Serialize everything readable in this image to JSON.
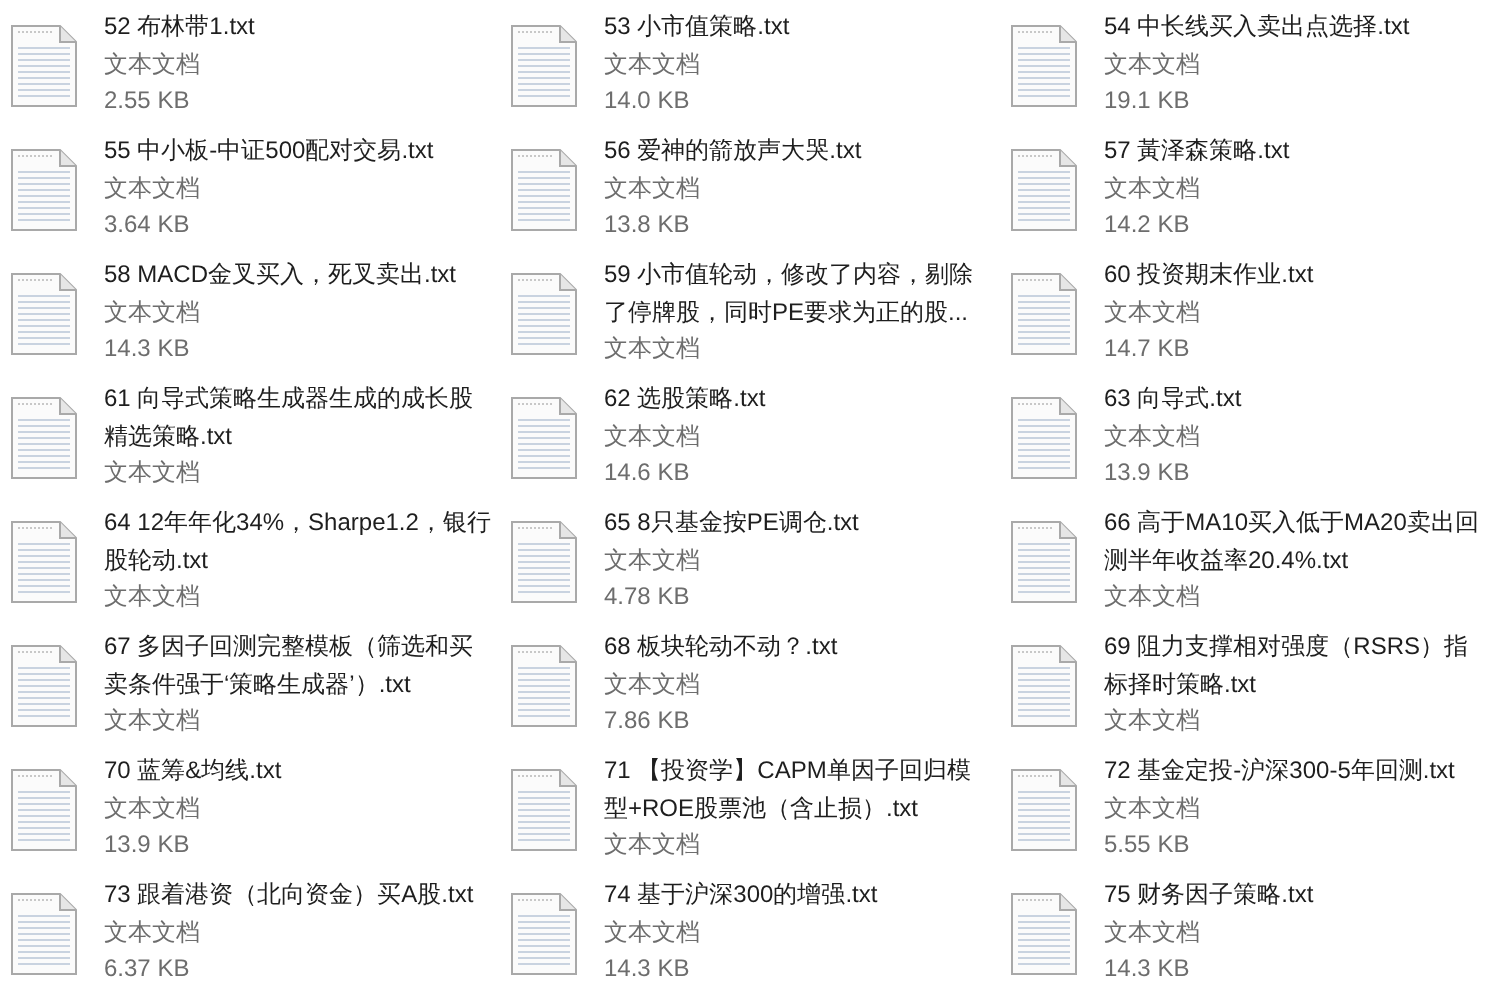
{
  "files": [
    {
      "name": "52 布林带1.txt",
      "type": "文本文档",
      "size": "2.55 KB"
    },
    {
      "name": "53 小市值策略.txt",
      "type": "文本文档",
      "size": "14.0 KB"
    },
    {
      "name": "54 中长线买入卖出点选择.txt",
      "type": "文本文档",
      "size": "19.1 KB"
    },
    {
      "name": "55 中小板-中证500配对交易.txt",
      "type": "文本文档",
      "size": "3.64 KB"
    },
    {
      "name": "56 爱神的箭放声大哭.txt",
      "type": "文本文档",
      "size": "13.8 KB"
    },
    {
      "name": "57 黃泽森策略.txt",
      "type": "文本文档",
      "size": "14.2 KB"
    },
    {
      "name": "58 MACD金叉买入，死叉卖出.txt",
      "type": "文本文档",
      "size": "14.3 KB"
    },
    {
      "name": "59 小市值轮动，修改了内容，剔除了停牌股，同时PE要求为正的股...",
      "type": "文本文档"
    },
    {
      "name": "60 投资期末作业.txt",
      "type": "文本文档",
      "size": "14.7 KB"
    },
    {
      "name": "61 向导式策略生成器生成的成长股精选策略.txt",
      "type": "文本文档"
    },
    {
      "name": "62 选股策略.txt",
      "type": "文本文档",
      "size": "14.6 KB"
    },
    {
      "name": "63 向导式.txt",
      "type": "文本文档",
      "size": "13.9 KB"
    },
    {
      "name": "64 12年年化34%，Sharpe1.2，银行股轮动.txt",
      "type": "文本文档"
    },
    {
      "name": "65 8只基金按PE调仓.txt",
      "type": "文本文档",
      "size": "4.78 KB"
    },
    {
      "name": "66 高于MA10买入低于MA20卖出回测半年收益率20.4%.txt",
      "type": "文本文档"
    },
    {
      "name": "67 多因子回测完整模板（筛选和买卖条件强于‘策略生成器’）.txt",
      "type": "文本文档"
    },
    {
      "name": "68 板块轮动不动？.txt",
      "type": "文本文档",
      "size": "7.86 KB"
    },
    {
      "name": "69 阻力支撑相对强度（RSRS）指标择时策略.txt",
      "type": "文本文档"
    },
    {
      "name": "70 蓝筹&均线.txt",
      "type": "文本文档",
      "size": "13.9 KB"
    },
    {
      "name": "71 【投资学】CAPM单因子回归模型+ROE股票池（含止损）.txt",
      "type": "文本文档"
    },
    {
      "name": "72 基金定投-沪深300-5年回测.txt",
      "type": "文本文档",
      "size": "5.55 KB"
    },
    {
      "name": "73 跟着港资（北向资金）买A股.txt",
      "type": "文本文档",
      "size": "6.37 KB"
    },
    {
      "name": "74 基于沪深300的增强.txt",
      "type": "文本文档",
      "size": "14.3 KB"
    },
    {
      "name": "75 财务因子策略.txt",
      "type": "文本文档",
      "size": "14.3 KB"
    }
  ]
}
